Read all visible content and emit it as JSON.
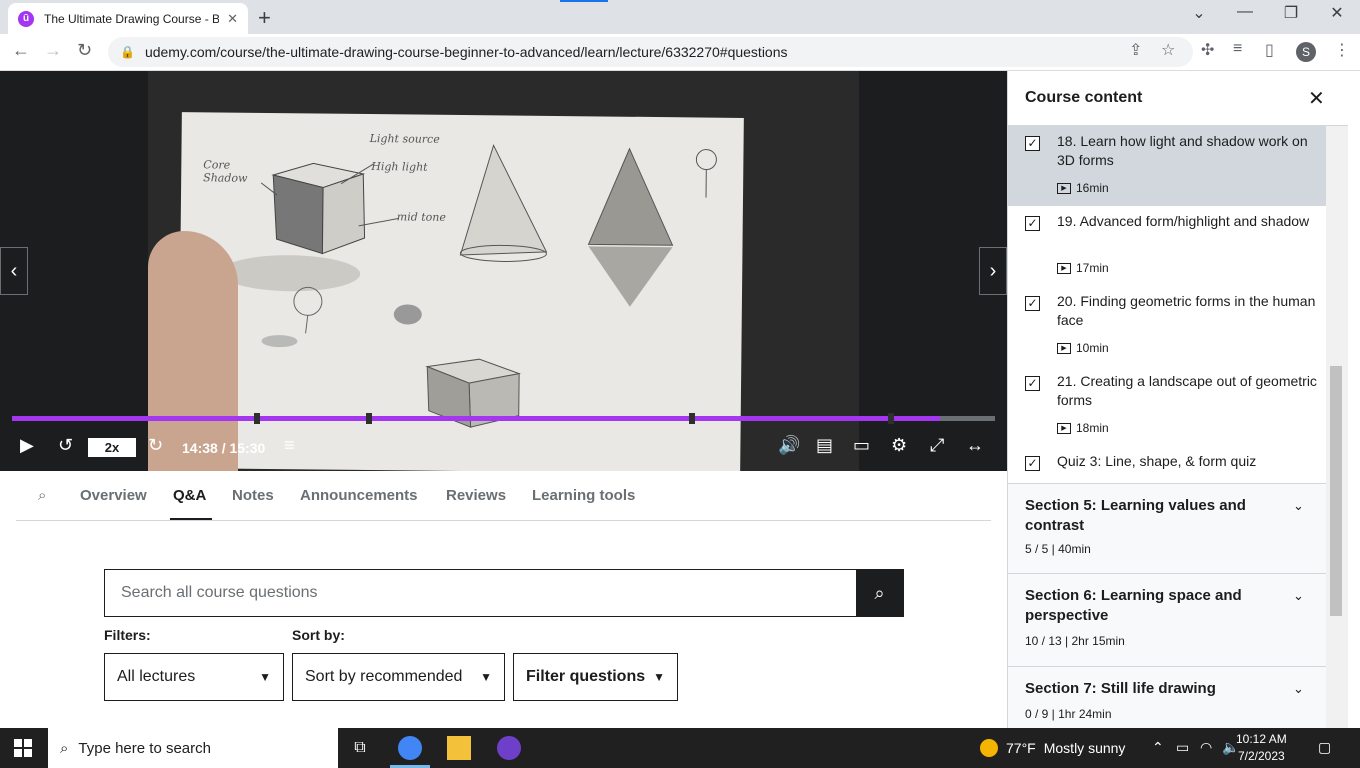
{
  "browser": {
    "tab_title": "The Ultimate Drawing Course - B",
    "tab_favicon": "udemy-icon",
    "url": "udemy.com/course/the-ultimate-drawing-course-beginner-to-advanced/learn/lecture/6332270#questions",
    "profile_initial": "S"
  },
  "player": {
    "speed": "2x",
    "timecode": "14:38 / 15:30",
    "progress_fraction": 0.944,
    "sketch_labels": [
      "Light source",
      "High light",
      "Core Shadow",
      "mid tone"
    ],
    "accent_color": "#a435f0"
  },
  "course_tabs": {
    "items": [
      "Overview",
      "Q&A",
      "Notes",
      "Announcements",
      "Reviews",
      "Learning tools"
    ],
    "active": "Q&A"
  },
  "qa": {
    "search_placeholder": "Search all course questions",
    "filters_label": "Filters:",
    "sort_label": "Sort by:",
    "filter_value": "All lectures",
    "sort_value": "Sort by recommended",
    "filter_questions_label": "Filter questions"
  },
  "sidebar": {
    "title": "Course content",
    "lectures": [
      {
        "title": "18. Learn how light and shadow work on 3D forms",
        "duration": "16min",
        "checked": true,
        "current": true
      },
      {
        "title": "19. Advanced form/highlight and shadow",
        "duration": "17min",
        "checked": true,
        "current": false
      },
      {
        "title": "20. Finding geometric forms in the human face",
        "duration": "10min",
        "checked": true,
        "current": false
      },
      {
        "title": "21. Creating a landscape out of geometric forms",
        "duration": "18min",
        "checked": true,
        "current": false
      },
      {
        "title": "Quiz 3: Line, shape, & form quiz",
        "duration": "",
        "checked": true,
        "current": false
      }
    ],
    "sections": [
      {
        "title": "Section 5: Learning values and contrast",
        "meta": "5 / 5 | 40min"
      },
      {
        "title": "Section 6: Learning space and perspective",
        "meta": "10 / 13 | 2hr 15min"
      },
      {
        "title": "Section 7: Still life drawing",
        "meta": "0 / 9 | 1hr 24min"
      }
    ]
  },
  "taskbar": {
    "search_placeholder": "Type here to search",
    "weather_temp": "77°F",
    "weather_text": "Mostly sunny",
    "time": "10:12 AM",
    "date": "7/2/2023"
  }
}
